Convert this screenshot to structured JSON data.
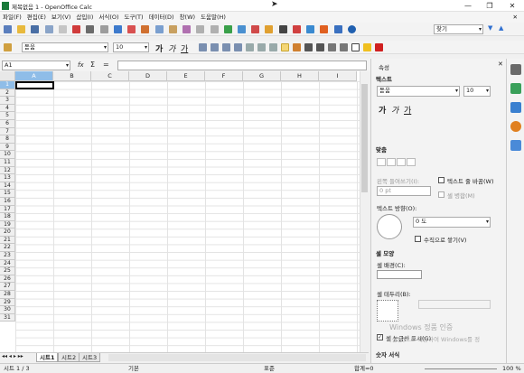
{
  "window": {
    "title": "제목없음 1 - OpenOffice Calc",
    "min": "—",
    "max": "❐",
    "close": "✕"
  },
  "menu": [
    "파일(F)",
    "편집(E)",
    "보기(V)",
    "삽입(I)",
    "서식(O)",
    "도구(T)",
    "데이터(D)",
    "창(W)",
    "도움말(H)"
  ],
  "toolbar": {
    "search_placeholder": "찾기",
    "font_name": "돋움",
    "font_size": "10",
    "bold": "가",
    "italic": "가",
    "underline": "가"
  },
  "formula": {
    "name_box": "A1",
    "fx": "fx",
    "sigma": "Σ",
    "equals": "="
  },
  "grid": {
    "columns": [
      "A",
      "B",
      "C",
      "D",
      "E",
      "F",
      "G",
      "H",
      "I"
    ],
    "rows": [
      "1",
      "2",
      "3",
      "4",
      "5",
      "6",
      "7",
      "8",
      "9",
      "10",
      "11",
      "12",
      "13",
      "14",
      "15",
      "16",
      "17",
      "18",
      "19",
      "20",
      "21",
      "22",
      "23",
      "24",
      "25",
      "26",
      "27",
      "28",
      "29",
      "30",
      "31"
    ]
  },
  "sheets": [
    "시트1",
    "시트2",
    "시트3"
  ],
  "status": {
    "sheet": "시트 1 / 3",
    "style": "기본",
    "mode": "표준",
    "sum": "합계=0",
    "zoom": "100 %"
  },
  "sidebar": {
    "title": "속성",
    "text_section": "텍스트",
    "font_name": "돋움",
    "font_size": "10",
    "align_section": "맞춤",
    "indent_label": "왼쪽 들여쓰기(I):",
    "indent_value": "0 pt",
    "wrap_label": "텍스트 줄 바꿈(W)",
    "merge_label": "셀 병합(M)",
    "orient_label": "텍스트 방향(O):",
    "angle_value": "0 도",
    "vertical_label": "수직으로 쌓기(V)",
    "cell_section": "셀 모양",
    "bg_label": "셀 배경(C):",
    "border_label": "셀 테두리(B):",
    "gridlines_label": "셀 눈금선 표시(G)",
    "number_section": "숫자 서식"
  },
  "watermark": {
    "line1": "Windows 정품 인증",
    "line2": "[설정]으로 이동하여 Windows를 정"
  }
}
